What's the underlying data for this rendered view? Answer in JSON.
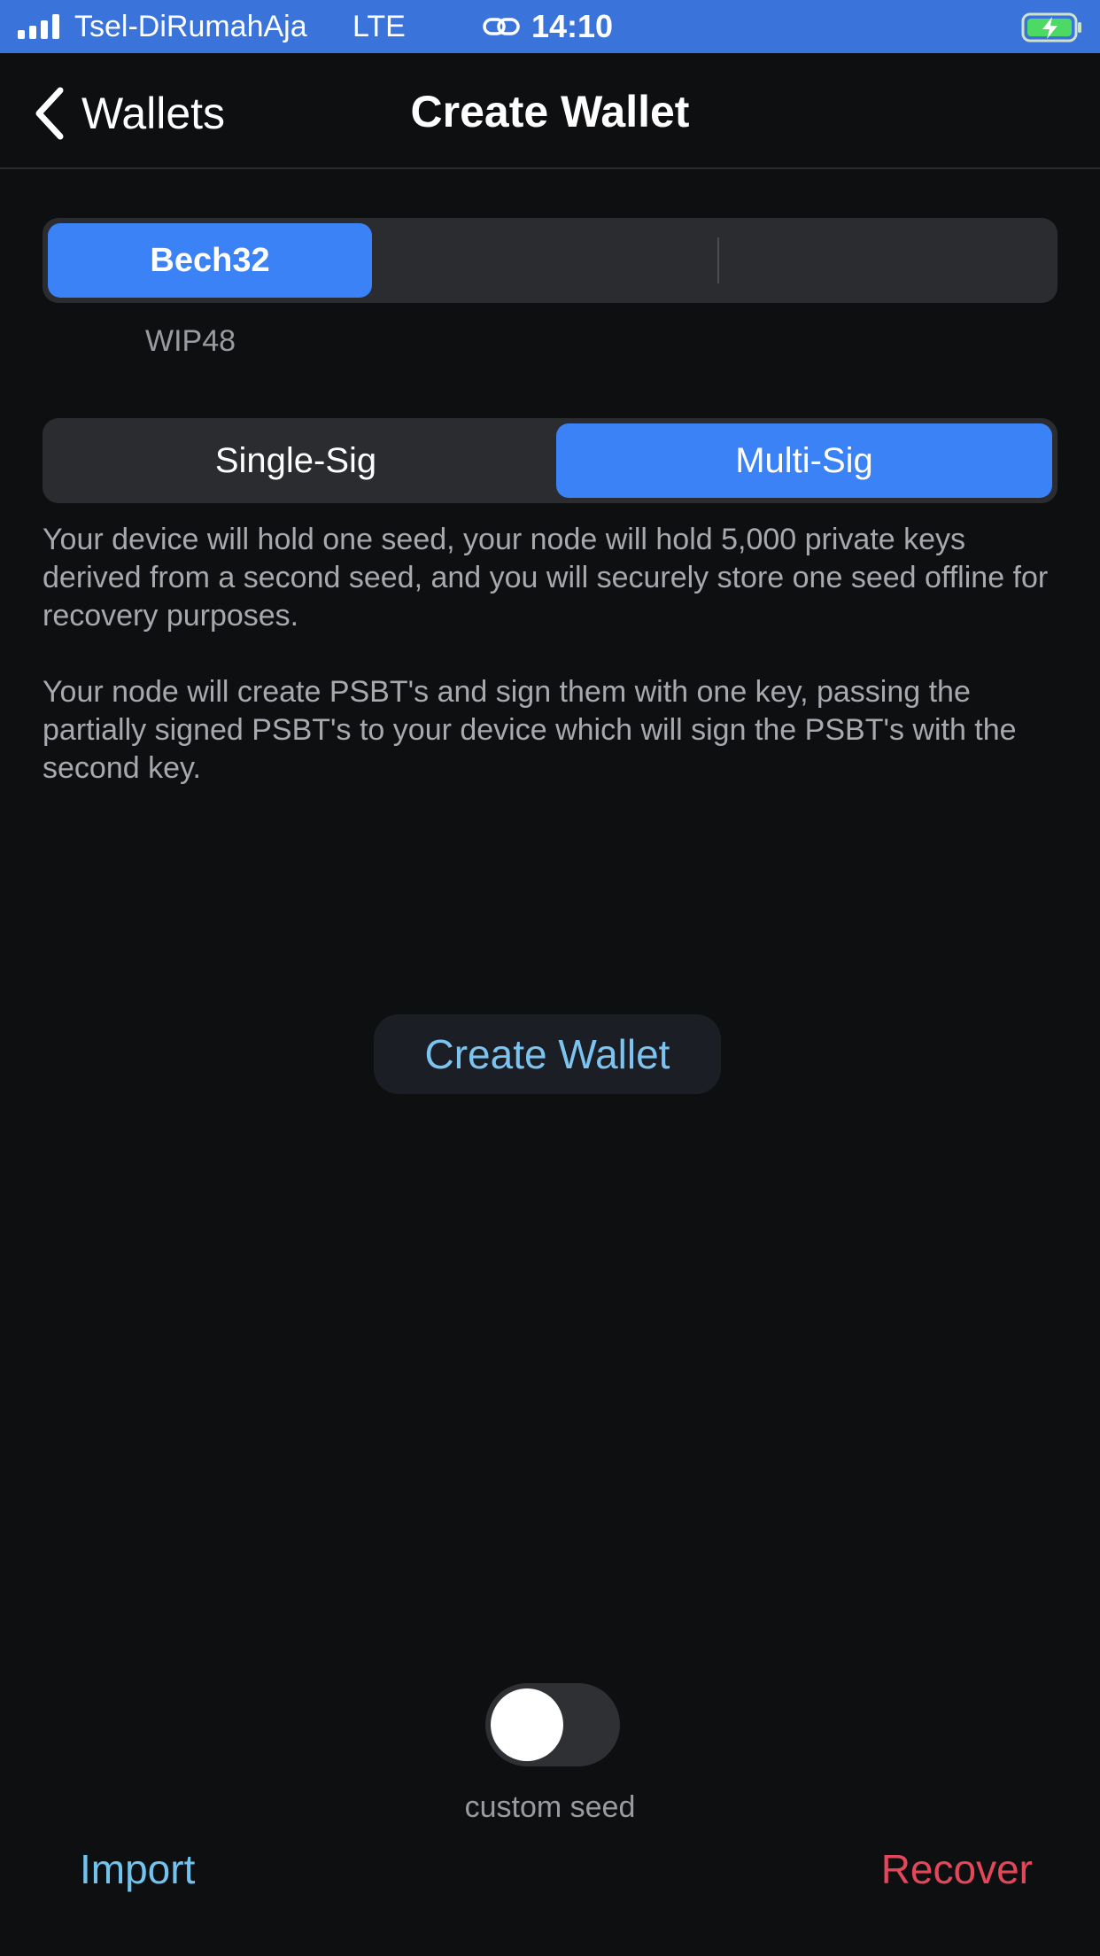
{
  "status_bar": {
    "carrier": "Tsel-DiRumahAja",
    "network": "LTE",
    "time": "14:10",
    "icons": [
      "signal-bars-icon",
      "link-icon",
      "battery-charging-icon"
    ]
  },
  "nav": {
    "back_label": "Wallets",
    "title": "Create Wallet"
  },
  "address_type": {
    "selected": "Bech32",
    "sub_label": "WIP48"
  },
  "wallet_type": {
    "options": [
      "Single-Sig",
      "Multi-Sig"
    ],
    "selected": "Multi-Sig"
  },
  "description": {
    "paragraph1": "Your device will hold one seed, your node will hold 5,000 private keys derived from a second seed, and you will securely store one seed offline for recovery purposes.",
    "paragraph2": "Your node will create PSBT's and sign them with one key, passing the partially signed PSBT's to your device which will sign the PSBT's with the second key."
  },
  "create_button_label": "Create Wallet",
  "custom_seed": {
    "label": "custom seed",
    "enabled": false
  },
  "footer": {
    "import_label": "Import",
    "recover_label": "Recover"
  },
  "colors": {
    "status_bar": "#3a73d9",
    "accent_blue": "#3b82f6",
    "link_blue": "#72c3ee",
    "recover_red": "#e2475a",
    "background": "#0e0f11"
  }
}
